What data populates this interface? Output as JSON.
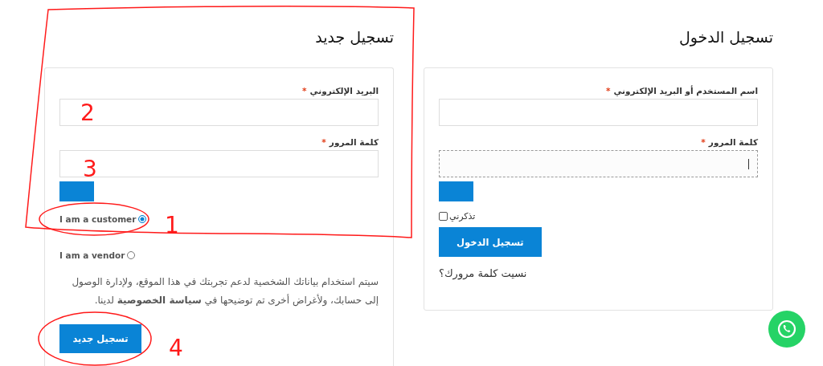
{
  "login": {
    "title": "تسجيل الدخول",
    "fields": [
      {
        "label": "اسم المستخدم أو البريد الإلكتروني",
        "required_mark": "*",
        "focused": false
      },
      {
        "label": "كلمة المرور",
        "required_mark": "*",
        "focused": true
      }
    ],
    "remember": {
      "label": "تذكرني",
      "checked": false
    },
    "submit": "تسجيل الدخول",
    "lost_password": "نسيت كلمة مرورك؟"
  },
  "register": {
    "title": "تسجيل جديد",
    "fields": [
      {
        "label": "البريد الإلكتروني",
        "required_mark": "*",
        "focused": false
      },
      {
        "label": "كلمة المرور",
        "required_mark": "*",
        "focused": false
      }
    ],
    "roles": [
      {
        "label": "I am a customer",
        "selected": true
      },
      {
        "label": "I am a vendor",
        "selected": false
      }
    ],
    "privacy_text": "سيتم استخدام بياناتك الشخصية لدعم تجربتك في هذا الموقع، ولإدارة الوصول إلى حسابك، ولأغراض أخرى تم توضيحها في **سياسة الخصوصية** لدينا.",
    "submit": "تسجيل جديد"
  },
  "annotations": [
    {
      "label": "2"
    },
    {
      "label": "3"
    },
    {
      "label": "1"
    },
    {
      "label": "4"
    }
  ]
}
